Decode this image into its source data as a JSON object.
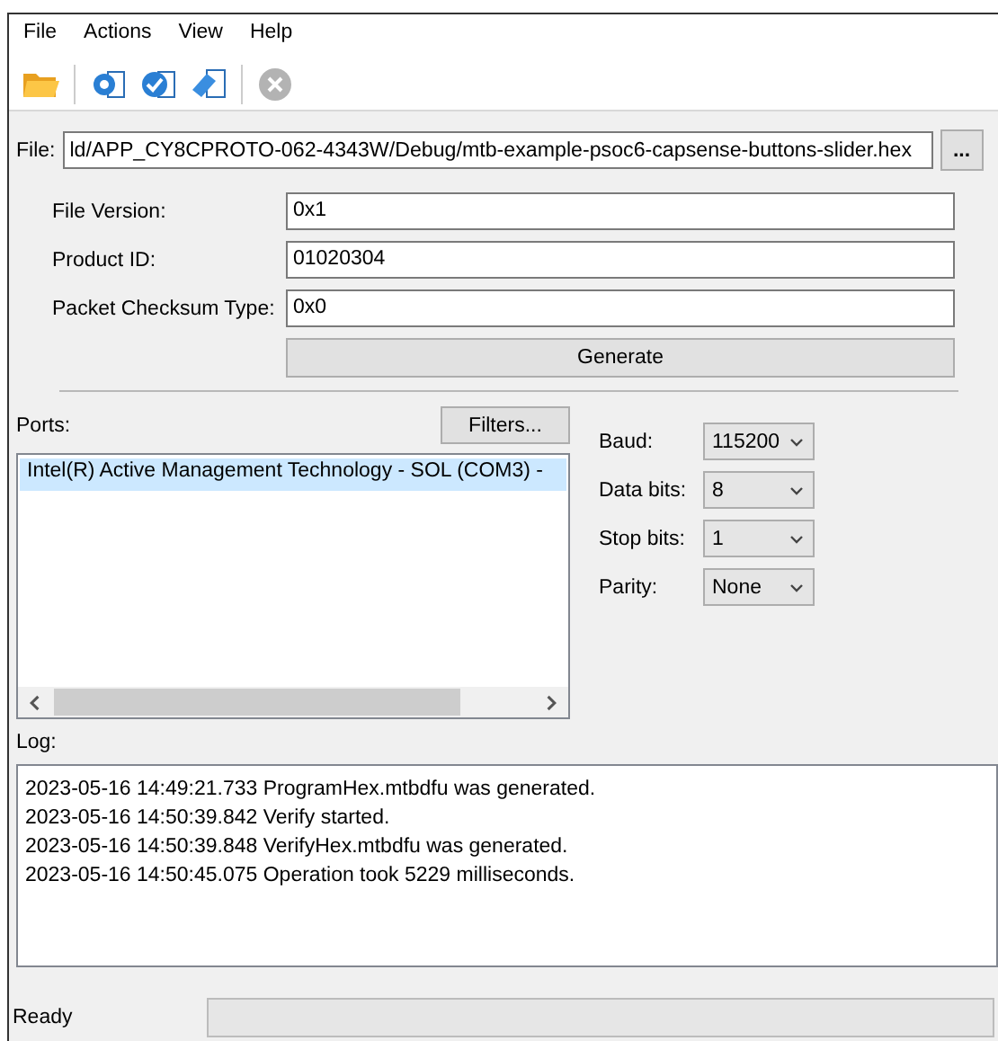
{
  "menu": [
    "File",
    "Actions",
    "View",
    "Help"
  ],
  "toolbar": [
    {
      "kind": "folder",
      "disabled": false
    },
    {
      "kind": "gear-doc",
      "disabled": false
    },
    {
      "kind": "check-doc",
      "disabled": false
    },
    {
      "kind": "eraser-doc",
      "disabled": false
    },
    {
      "kind": "cancel",
      "disabled": true
    }
  ],
  "file": {
    "label": "File:",
    "value": "ld/APP_CY8CPROTO-062-4343W/Debug/mtb-example-psoc6-capsense-buttons-slider.hex",
    "browse": "..."
  },
  "fields": [
    {
      "label": "File Version:",
      "value": "0x1"
    },
    {
      "label": "Product ID:",
      "value": "01020304"
    },
    {
      "label": "Packet Checksum Type:",
      "value": "0x0"
    }
  ],
  "generate": "Generate",
  "ports": {
    "label": "Ports:",
    "filters": "Filters...",
    "items": [
      {
        "text": "Intel(R) Active Management Technology - SOL (COM3) -",
        "selected": true
      }
    ]
  },
  "serial": [
    {
      "label": "Baud:",
      "value": "115200"
    },
    {
      "label": "Data bits:",
      "value": "8"
    },
    {
      "label": "Stop bits:",
      "value": "1"
    },
    {
      "label": "Parity:",
      "value": "None"
    }
  ],
  "log": {
    "label": "Log:",
    "lines": [
      "2023-05-16 14:49:21.733 ProgramHex.mtbdfu was generated.",
      "2023-05-16 14:50:39.842 Verify started.",
      "2023-05-16 14:50:39.848 VerifyHex.mtbdfu was generated.",
      "2023-05-16 14:50:45.075 Operation took 5229 milliseconds."
    ]
  },
  "status_bar": {
    "text": "Ready",
    "progress": {
      "level": 0
    }
  }
}
